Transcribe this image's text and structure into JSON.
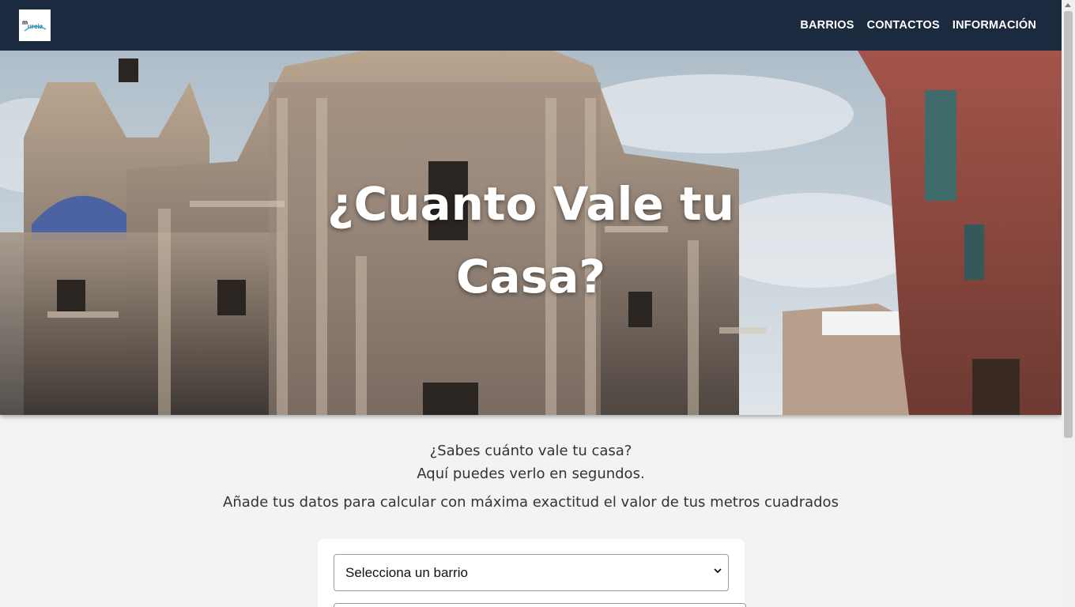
{
  "header": {
    "logo_text": "murcia",
    "nav": [
      {
        "label": "BARRIOS"
      },
      {
        "label": "CONTACTOS"
      },
      {
        "label": "INFORMACIÓN"
      }
    ]
  },
  "hero": {
    "title": "¿Cuanto Vale tu Casa?",
    "background": "cathedral-photo"
  },
  "intro": {
    "line1": "¿Sabes cuánto vale tu casa?",
    "line2": "Aquí puedes verlo en segundos.",
    "line3": "Añade tus datos para calcular con máxima exactitud el valor de tus metros cuadrados"
  },
  "form": {
    "barrio_select": {
      "selected": "Selecciona un barrio"
    }
  },
  "colors": {
    "navbar_bg": "#1b2a3e",
    "page_bg": "#f3f3f3",
    "text": "#333333"
  }
}
